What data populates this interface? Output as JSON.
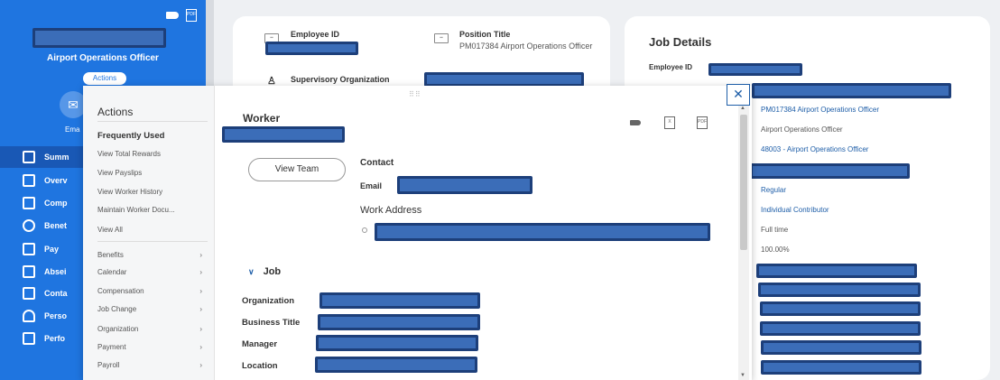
{
  "sidebar": {
    "job_title": "Airport Operations Officer",
    "actions_label": "Actions",
    "email_short": "Ema",
    "nav": [
      {
        "label": "Summ",
        "icon": "summary-grid-icon"
      },
      {
        "label": "Overv",
        "icon": "overview-icon"
      },
      {
        "label": "Comp",
        "icon": "compensation-chart-icon"
      },
      {
        "label": "Benet",
        "icon": "benefits-shield-icon"
      },
      {
        "label": "Pay",
        "icon": "wallet-icon"
      },
      {
        "label": "Absei",
        "icon": "calendar-icon"
      },
      {
        "label": "Conta",
        "icon": "contact-icon"
      },
      {
        "label": "Perso",
        "icon": "person-icon"
      },
      {
        "label": "Perfo",
        "icon": "performance-chart-icon"
      }
    ]
  },
  "top_card": {
    "employee_id_label": "Employee ID",
    "position_title_label": "Position Title",
    "position_title_value": "PM017384 Airport Operations Officer",
    "supervisory_org_label": "Supervisory Organization"
  },
  "job_details": {
    "title": "Job Details",
    "employee_id_label": "Employee ID",
    "values": [
      {
        "text": "PM017384 Airport Operations Officer",
        "link": true
      },
      {
        "text": "Airport Operations Officer",
        "link": false
      },
      {
        "text": "48003 - Airport Operations Officer",
        "link": true
      },
      {
        "text": "Regular",
        "link": true
      },
      {
        "text": "Individual Contributor",
        "link": true
      },
      {
        "text": "Full time",
        "link": false
      },
      {
        "text": "100.00%",
        "link": false
      }
    ]
  },
  "actions_menu": {
    "heading": "Actions",
    "frequently_used": "Frequently Used",
    "frequent_items": [
      "View Total Rewards",
      "View Payslips",
      "View Worker History",
      "Maintain Worker Docu...",
      "View All"
    ],
    "category_items": [
      "Benefits",
      "Calendar",
      "Compensation",
      "Job Change",
      "Organization",
      "Payment",
      "Payroll"
    ]
  },
  "worker": {
    "title": "Worker",
    "view_team": "View Team",
    "contact_label": "Contact",
    "email_label": "Email",
    "work_address_label": "Work Address",
    "job_section": "Job",
    "fields": [
      "Organization",
      "Business Title",
      "Manager",
      "Location"
    ]
  },
  "modal": {
    "close_symbol": "✕"
  },
  "colors": {
    "sidebar_blue": "#1f75e0",
    "link_blue": "#1e5ea8",
    "redaction": "#3b6db8"
  }
}
